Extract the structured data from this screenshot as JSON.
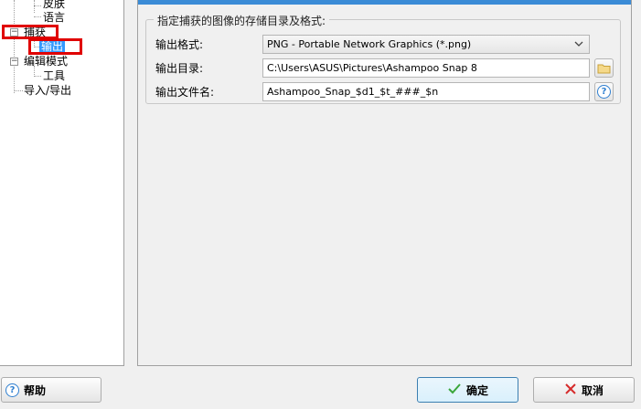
{
  "tree": {
    "items": [
      {
        "label": "皮肤"
      },
      {
        "label": "语言"
      },
      {
        "label": "捕获"
      },
      {
        "label": "输出"
      },
      {
        "label": "编辑模式"
      },
      {
        "label": "工具"
      },
      {
        "label": "导入/导出"
      }
    ]
  },
  "panel": {
    "group_title": "指定捕获的图像的存储目录及格式:",
    "format_label": "输出格式:",
    "format_value": "PNG - Portable Network Graphics (*.png)",
    "dir_label": "输出目录:",
    "dir_value": "C:\\Users\\ASUS\\Pictures\\Ashampoo Snap 8",
    "filename_label": "输出文件名:",
    "filename_value": "Ashampoo_Snap_$d1_$t_###_$n"
  },
  "buttons": {
    "help": "帮助",
    "ok": "确定",
    "cancel": "取消"
  },
  "icons": {
    "expand_minus": "−",
    "dropdown": "chevron-down-icon",
    "folder": "folder-icon",
    "help_circle": "?",
    "check": "check-icon",
    "cancel_x": "x-icon"
  },
  "colors": {
    "selection": "#3399ff",
    "highlight_box": "#e00000",
    "accent_bar": "#3a8bd6"
  }
}
